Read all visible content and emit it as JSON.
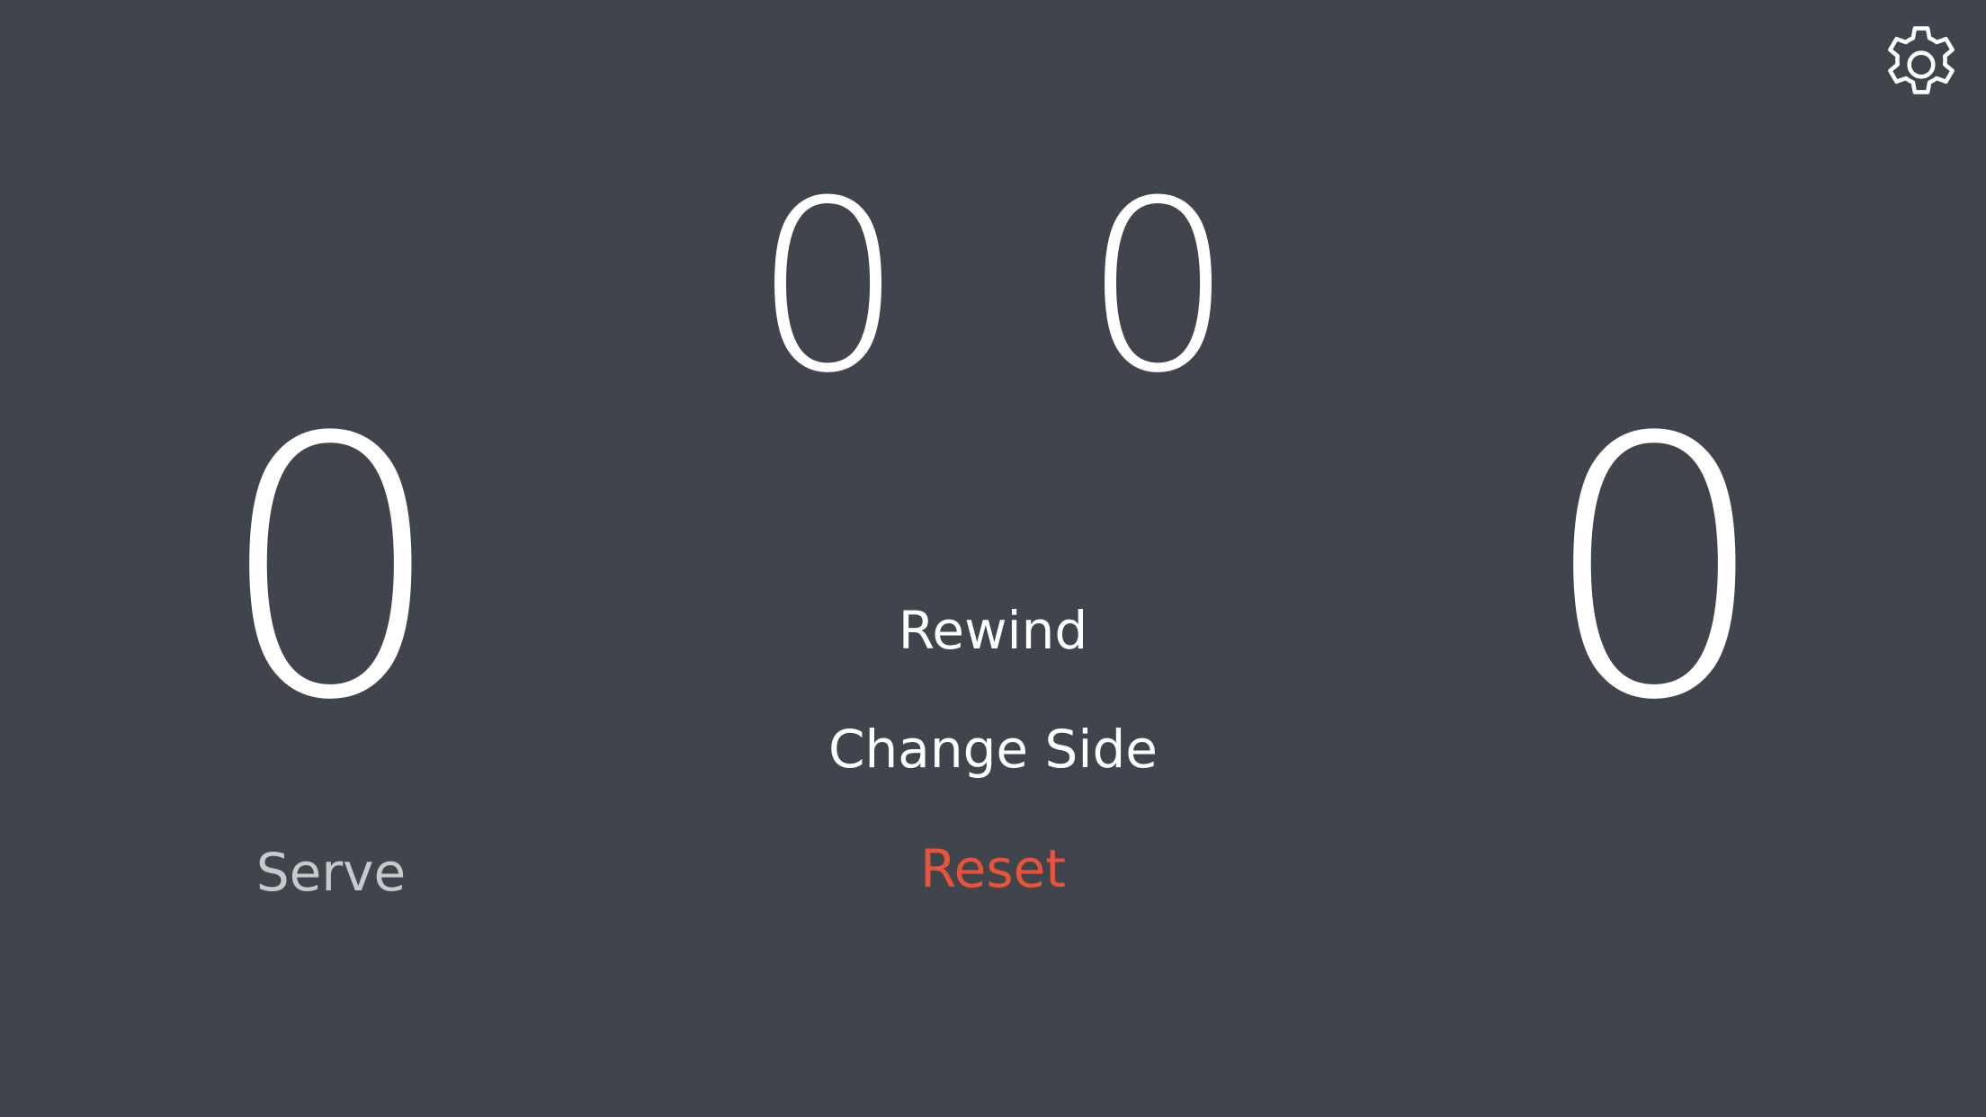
{
  "settings": {
    "icon": "gear-icon"
  },
  "sets": {
    "left": "0",
    "right": "0"
  },
  "points": {
    "left": "0",
    "right": "0"
  },
  "actions": {
    "rewind": "Rewind",
    "change_side": "Change Side",
    "reset": "Reset"
  },
  "serve_label": "Serve",
  "colors": {
    "background": "#40444c",
    "text": "#ffffff",
    "reset": "#e8533b",
    "serve": "#c9c9cc"
  }
}
